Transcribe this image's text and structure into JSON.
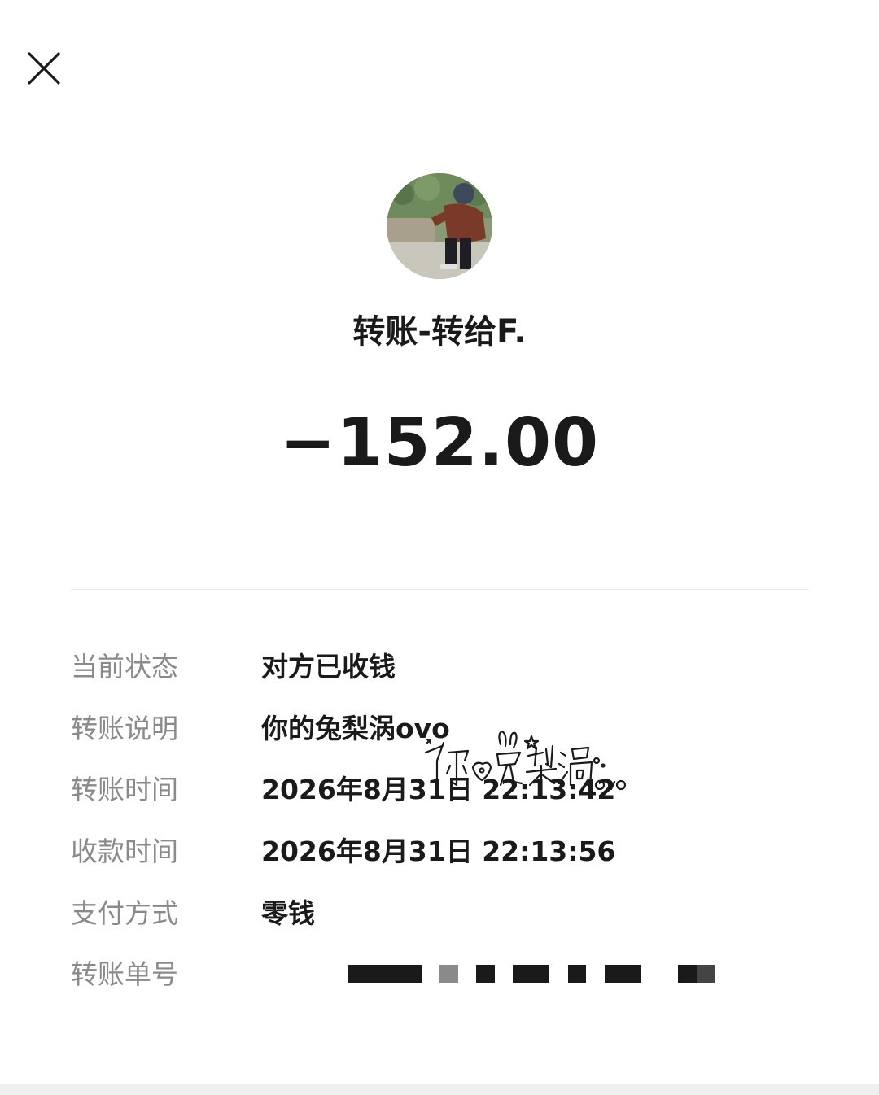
{
  "header": {
    "close_icon": "close-icon"
  },
  "payee": {
    "avatar_icon": "avatar-photo",
    "title": "转账-转给F."
  },
  "amount": "−152.00",
  "details": [
    {
      "label": "当前状态",
      "value": "对方已收钱"
    },
    {
      "label": "转账说明",
      "value": "你的兔梨涡ovo"
    },
    {
      "label": "转账时间",
      "value": "2026年8月31日 22:13:42"
    },
    {
      "label": "收款时间",
      "value": "2026年8月31日 22:13:56"
    },
    {
      "label": "支付方式",
      "value": "零钱"
    },
    {
      "label": "转账单号",
      "value": ""
    }
  ],
  "sticker": {
    "text": "你的兔梨涡ovo"
  },
  "colors": {
    "text_primary": "#1a1a1a",
    "text_secondary": "#8a8a8a",
    "divider": "#e8e8e8",
    "background": "#ffffff"
  }
}
